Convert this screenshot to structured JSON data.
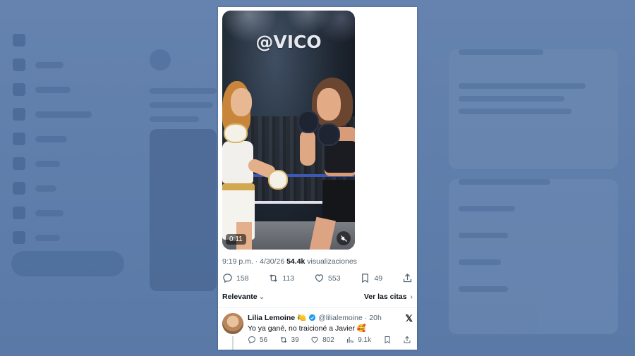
{
  "video": {
    "watermark": "@VICO",
    "duration": "0:11"
  },
  "tweet": {
    "time": "9:19 p.m.",
    "separator": " · ",
    "date": "4/30/26",
    "views_count": "54.4k",
    "views_label": " visualizaciones",
    "replies": "158",
    "reposts": "113",
    "likes": "553",
    "bookmarks": "49"
  },
  "filters": {
    "sort_label": "Relevante",
    "quotes_label": "Ver las citas"
  },
  "reply": {
    "name": "Lilia Lemoine",
    "name_emoji": "🍋",
    "handle": "@lilialemoine",
    "time_sep": " · ",
    "age": "20h",
    "text": "Yo ya gané, no traicioné a Javier 🥰",
    "replies": "56",
    "reposts": "39",
    "likes": "802",
    "views": "9.1k"
  },
  "colors": {
    "verified": "#1d9bf0",
    "text_secondary": "#536471",
    "text_primary": "#0f1419"
  },
  "icons": [
    "reply-icon",
    "repost-icon",
    "like-icon",
    "bookmark-icon",
    "share-icon",
    "views-icon",
    "verified-icon",
    "x-logo-icon",
    "mute-icon",
    "chevron-down-icon",
    "chevron-right-icon"
  ]
}
